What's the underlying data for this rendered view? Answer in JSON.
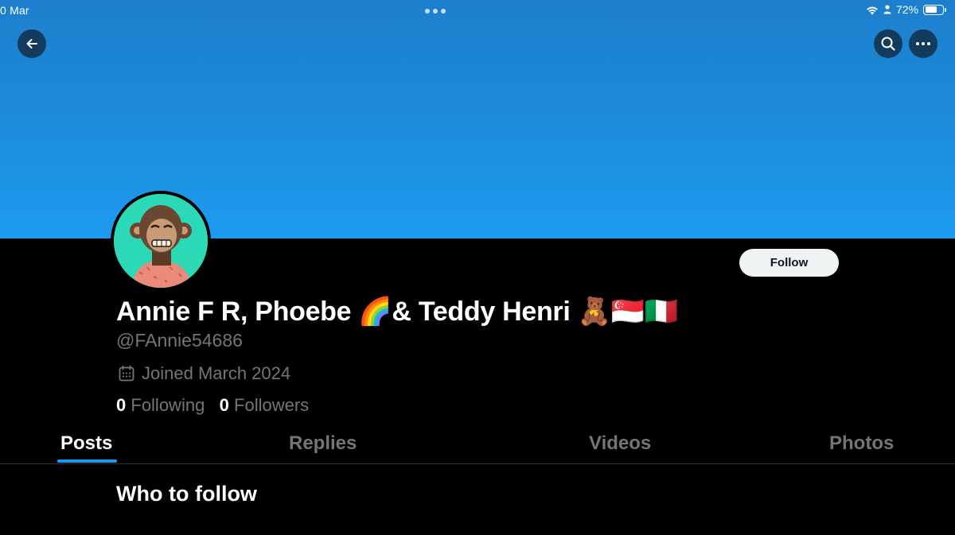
{
  "status_bar": {
    "time": "0 Mar",
    "battery_text": "72%",
    "battery_level": 0.72
  },
  "header": {
    "back_icon": "arrow-left-icon",
    "search_icon": "search-icon",
    "more_icon": "more-horizontal-icon",
    "banner_color": "#1d9bf0"
  },
  "profile": {
    "display_name": "Annie F R, Phoebe 🌈& Teddy Henri 🧸🇸🇬🇮🇹",
    "handle": "@FAnnie54686",
    "joined": "Joined March 2024",
    "following_count": "0",
    "following_label": "Following",
    "followers_count": "0",
    "followers_label": "Followers",
    "follow_button": "Follow",
    "avatar_icon": "ape-avatar"
  },
  "tabs": [
    {
      "label": "Posts",
      "active": true
    },
    {
      "label": "Replies",
      "active": false
    },
    {
      "label": "Videos",
      "active": false
    },
    {
      "label": "Photos",
      "active": false
    }
  ],
  "main": {
    "who_to_follow_title": "Who to follow"
  }
}
